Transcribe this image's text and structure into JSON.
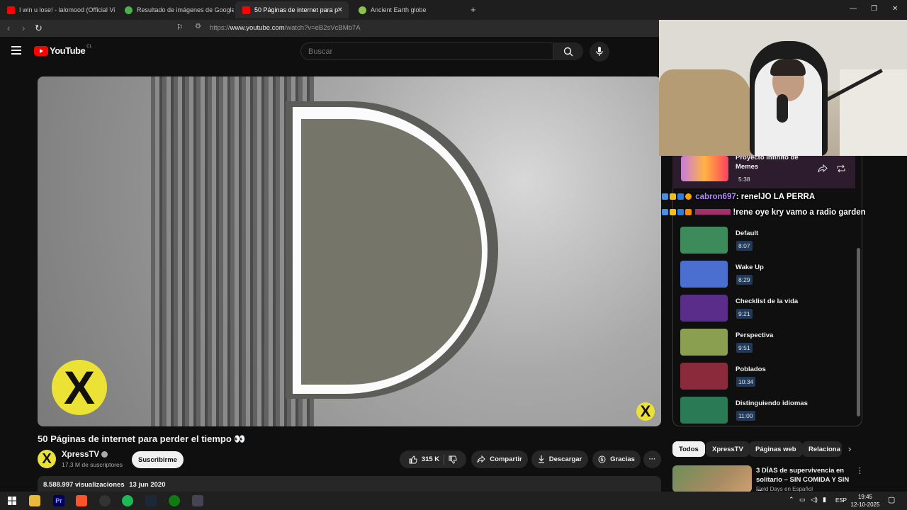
{
  "browser": {
    "tabs": [
      {
        "title": "I win u lose! - lalomood (Official Visu",
        "favicon_color": "#ff0000"
      },
      {
        "title": "Resultado de imágenes de Google",
        "favicon_color": "#4caf50"
      },
      {
        "title": "50 Páginas de internet para p",
        "favicon_color": "#ff0000"
      },
      {
        "title": "Ancient Earth globe",
        "favicon_color": "#8bc34a"
      }
    ],
    "close_glyph": "✕",
    "new_tab_glyph": "+",
    "url_prefix": "https://",
    "url_host": "www.youtube.com",
    "url_path": "/watch?v=eB2sVcBMb7A"
  },
  "youtube": {
    "logo_text": "YouTube",
    "region": "CL",
    "search_placeholder": "Buscar"
  },
  "video": {
    "title": "50 Páginas de internet para perder el tiempo 👀",
    "channel": "XpressTV",
    "subscribers": "17,3 M de suscriptores",
    "subscribe_label": "Suscribirme",
    "likes": "315 K",
    "share_label": "Compartir",
    "download_label": "Descargar",
    "thanks_label": "Gracias",
    "more_glyph": "···",
    "views": "8.588.997 visualizaciones",
    "date": "13 jun 2020",
    "logo_glyph": "X"
  },
  "playlist": {
    "current": {
      "title": "Proyecto infinito de Memes",
      "duration": "5:38"
    },
    "items": [
      {
        "title": "Default",
        "duration": "8:07",
        "color": "#3d8a5a"
      },
      {
        "title": "Wake Up",
        "duration": "8:29",
        "color": "#4a6fd0"
      },
      {
        "title": "Checklist de la vida",
        "duration": "9:21",
        "color": "#5a2d8a"
      },
      {
        "title": "Perspectiva",
        "duration": "9:51",
        "color": "#8aa050"
      },
      {
        "title": "Poblados",
        "duration": "10:34",
        "color": "#8a2a3a"
      },
      {
        "title": "Distinguiendo idiomas",
        "duration": "11:00",
        "color": "#2a7a55"
      }
    ]
  },
  "chat": [
    {
      "user": "cabron697",
      "message": ": renelJO LA PERRA"
    },
    {
      "user": "",
      "message": "!rene oye kry vamo a radio garden"
    }
  ],
  "chips": [
    "Todos",
    "XpressTV",
    "Páginas web",
    "Relaciona"
  ],
  "recommended": {
    "title": "3 DÍAS de supervivencia en solitario – SIN COMIDA Y SIN ...",
    "channel": "Field Days en Español"
  },
  "taskbar": {
    "language": "ESP",
    "time": "19:45",
    "date": "12-10-2025"
  }
}
